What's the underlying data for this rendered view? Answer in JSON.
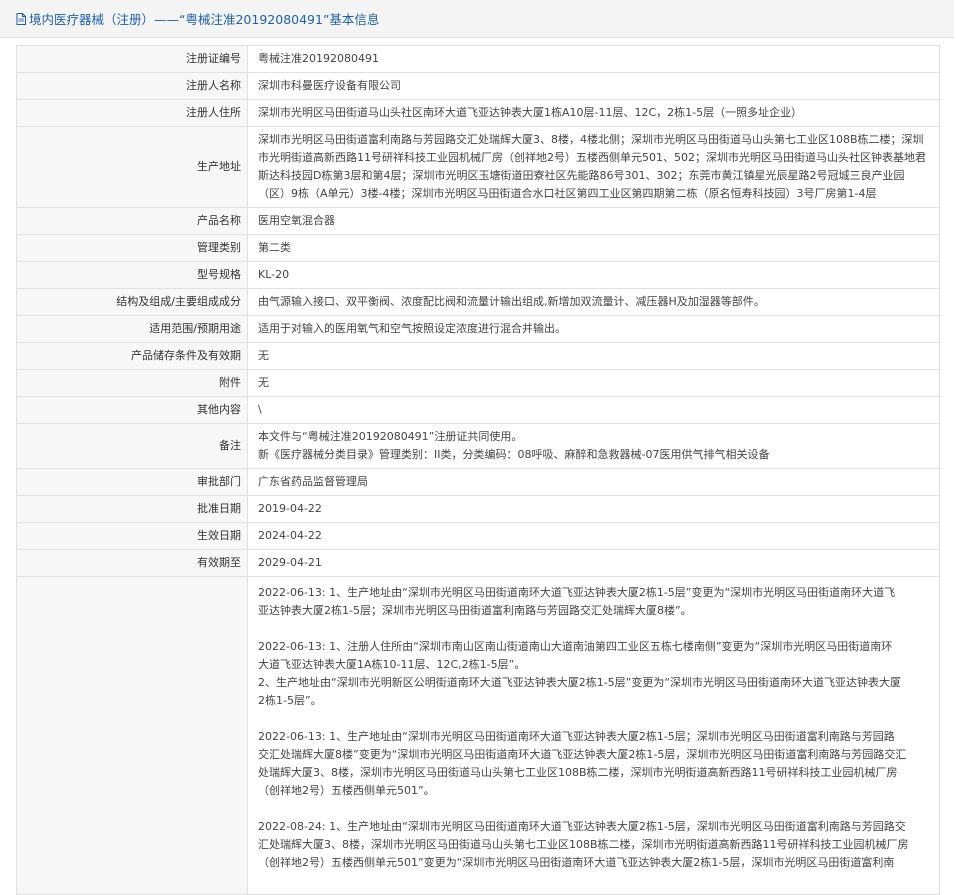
{
  "header": {
    "title": "境内医疗器械（注册）——“粤械注准20192080491”基本信息"
  },
  "rows": [
    {
      "label": "注册证编号",
      "value": "粤械注准20192080491"
    },
    {
      "label": "注册人名称",
      "value": "深圳市科曼医疗设备有限公司"
    },
    {
      "label": "注册人住所",
      "value": "深圳市光明区马田街道马山头社区南环大道飞亚达钟表大厦1栋A10层-11层、12C，2栋1-5层（一照多址企业）"
    },
    {
      "label": "生产地址",
      "value": "深圳市光明区马田街道富利南路与芳园路交汇处瑞辉大厦3、8楼，4楼北侧；深圳市光明区马田街道马山头第七工业区108B栋二楼；深圳市光明街道高新西路11号研祥科技工业园机械厂房（创祥地2号）五楼西侧单元501、502；深圳市光明区马田街道马山头社区钟表基地君斯达科技园D栋第3层和第4层；深圳市光明区玉塘街道田寮社区先能路86号301、302；东莞市黄江镇星光辰星路2号冠城三良产业园（区）9栋（A单元）3楼-4楼；深圳市光明区马田街道合水口社区第四工业区第四期第二栋（原名恒寿科技园）3号厂房第1-4层"
    },
    {
      "label": "产品名称",
      "value": "医用空氧混合器"
    },
    {
      "label": "管理类别",
      "value": "第二类"
    },
    {
      "label": "型号规格",
      "value": "KL-20"
    },
    {
      "label": "结构及组成/主要组成成分",
      "value": "由气源输入接口、双平衡阀、浓度配比阀和流量计输出组成,新增加双流量计、减压器H及加湿器等部件。"
    },
    {
      "label": "适用范围/预期用途",
      "value": "适用于对输入的医用氧气和空气按照设定浓度进行混合并输出。"
    },
    {
      "label": "产品储存条件及有效期",
      "value": "无"
    },
    {
      "label": "附件",
      "value": "无"
    },
    {
      "label": "其他内容",
      "value": "\\"
    }
  ],
  "remark": {
    "label": "备注",
    "line1": "本文件与“粤械注准20192080491”注册证共同使用。",
    "line2": "新《医疗器械分类目录》管理类别：II类，分类编码：08呼吸、麻醉和急救器械-07医用供气排气相关设备"
  },
  "rows2": [
    {
      "label": "审批部门",
      "value": "广东省药品监督管理局"
    },
    {
      "label": "批准日期",
      "value": "2019-04-22"
    },
    {
      "label": "生效日期",
      "value": "2024-04-22"
    },
    {
      "label": "有效期至",
      "value": "2029-04-21"
    }
  ],
  "changes": [
    {
      "lines": [
        "2022-06-13: 1、生产地址由“深圳市光明区马田街道南环大道飞亚达钟表大厦2栋1-5层”变更为“深圳市光明区马田街道南环大道飞",
        "亚达钟表大厦2栋1-5层；深圳市光明区马田街道富利南路与芳园路交汇处瑞辉大厦8楼”。"
      ]
    },
    {
      "lines": [
        "2022-06-13: 1、注册人住所由“深圳市南山区南山街道南山大道南油第四工业区五栋七楼南侧”变更为“深圳市光明区马田街道南环",
        "大道飞亚达钟表大厦1A栋10-11层、12C,2栋1-5层”。",
        "2、生产地址由“深圳市光明新区公明街道南环大道飞亚达钟表大厦2栋1-5层”变更为“深圳市光明区马田街道南环大道飞亚达钟表大厦",
        "2栋1-5层”。"
      ]
    },
    {
      "lines": [
        "2022-06-13: 1、生产地址由“深圳市光明区马田街道南环大道飞亚达钟表大厦2栋1-5层；深圳市光明区马田街道富利南路与芳园路",
        "交汇处瑞辉大厦8楼”变更为“深圳市光明区马田街道南环大道飞亚达钟表大厦2栋1-5层，深圳市光明区马田街道富利南路与芳园路交汇",
        "处瑞辉大厦3、8楼，深圳市光明区马田街道马山头第七工业区108B栋二楼，深圳市光明街道高新西路11号研祥科技工业园机械厂房",
        "（创祥地2号）五楼西侧单元501”。"
      ]
    },
    {
      "lines": [
        "2022-08-24: 1、生产地址由“深圳市光明区马田街道南环大道飞亚达钟表大厦2栋1-5层，深圳市光明区马田街道富利南路与芳园路交",
        "汇处瑞辉大厦3、8楼，深圳市光明区马田街道马山头第七工业区108B栋二楼，深圳市光明街道高新西路11号研祥科技工业园机械厂房",
        "（创祥地2号）五楼西侧单元501”变更为“深圳市光明区马田街道南环大道飞亚达钟表大厦2栋1-5层，深圳市光明区马田街道富利南"
      ]
    }
  ]
}
